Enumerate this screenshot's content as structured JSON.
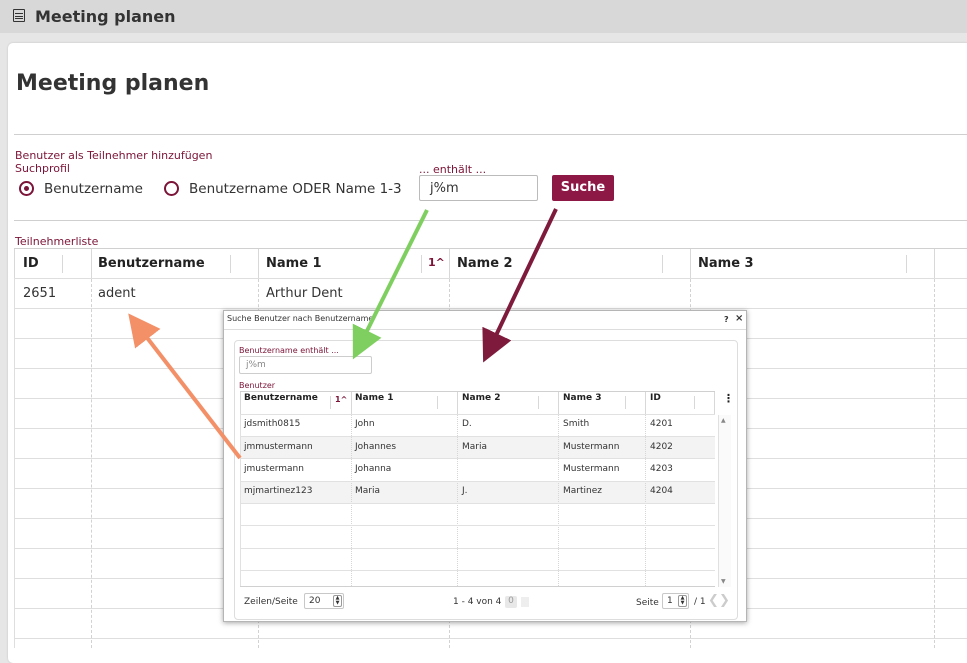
{
  "window": {
    "title": "Meeting planen"
  },
  "page": {
    "heading": "Meeting planen"
  },
  "search": {
    "section_label": "Benutzer als Teilnehmer hinzufügen",
    "profile_label": "Suchprofil",
    "option_username": "Benutzername",
    "option_username_or_name": "Benutzername ODER Name 1-3",
    "contains_label": "... enthält ...",
    "value": "j%m",
    "button_label": "Suche"
  },
  "participants": {
    "label": "Teilnehmerliste",
    "sort_indicator": "1^",
    "columns": [
      "ID",
      "Benutzername",
      "Name 1",
      "Name 2",
      "Name 3"
    ],
    "rows": [
      {
        "id": "2651",
        "username": "adent",
        "name1": "Arthur Dent",
        "name2": "",
        "name3": ""
      }
    ]
  },
  "dialog": {
    "title": "Suche Benutzer nach Benutzername",
    "help": "?",
    "close": "×",
    "field_label": "Benutzername enthält ...",
    "field_value": "j%m",
    "table_label": "Benutzer",
    "sort_indicator": "1^",
    "menu": "⋮",
    "columns": [
      "Benutzername",
      "Name 1",
      "Name 2",
      "Name 3",
      "ID"
    ],
    "rows": [
      {
        "username": "jdsmith0815",
        "name1": "John",
        "name2": "D.",
        "name3": "Smith",
        "id": "4201"
      },
      {
        "username": "jmmustermann",
        "name1": "Johannes",
        "name2": "Maria",
        "name3": "Mustermann",
        "id": "4202"
      },
      {
        "username": "jmustermann",
        "name1": "Johanna",
        "name2": "",
        "name3": "Mustermann",
        "id": "4203"
      },
      {
        "username": "mjmartinez123",
        "name1": "Maria",
        "name2": "J.",
        "name3": "Martinez",
        "id": "4204"
      }
    ],
    "footer": {
      "rows_per_page_label": "Zeilen/Seite",
      "rows_per_page": "20",
      "range": "1 - 4 von 4",
      "selected_count": "0",
      "page_label": "Seite",
      "page": "1",
      "page_total": "/ 1"
    }
  },
  "colors": {
    "accent": "#8d1845",
    "label": "#7b1438",
    "arrow_green": "#7fcf60",
    "arrow_red": "#7e1a3c",
    "arrow_orange": "#f39068"
  }
}
